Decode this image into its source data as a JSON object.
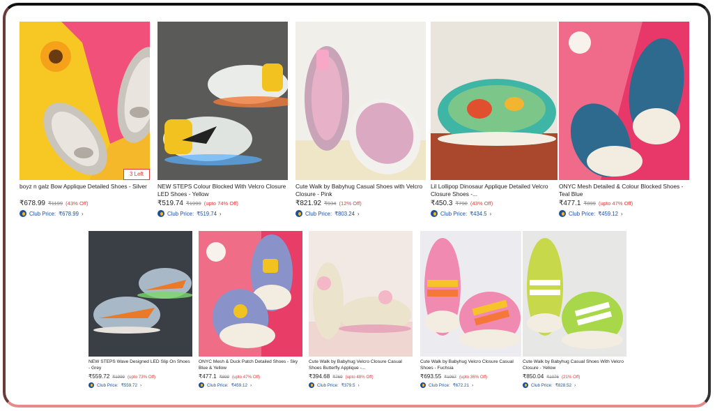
{
  "colors": {
    "club_blue": "#1d4f9c",
    "discount_red": "#e23b3b",
    "frame_bottom": "#e98a8a"
  },
  "products_row1": [
    {
      "title": "boyz n galz Bow Applique Detailed Shoes - Silver",
      "price": "₹678.99",
      "mrp": "₹1199",
      "discount": "(43% Off)",
      "club_label": "Club Price:",
      "club_price": "₹678.99",
      "badge": "3 Left",
      "chevron": "›"
    },
    {
      "title": "NEW STEPS Colour Blocked With Velcro Closure LED Shoes - Yellow",
      "price": "₹519.74",
      "mrp": "₹1999",
      "discount": "(upto 74% Off)",
      "club_label": "Club Price:",
      "club_price": "₹519.74",
      "chevron": "›"
    },
    {
      "title": "Cute Walk by Babyhug Casual Shoes with Velcro Closure - Pink",
      "price": "₹821.92",
      "mrp": "₹934",
      "discount": "(12% Off)",
      "club_label": "Club Price:",
      "club_price": "₹803.24",
      "chevron": "›"
    },
    {
      "title": "Lil Lollipop Dinosaur Applique Detailed Velcro Closure Shoes -...",
      "price": "₹450.3",
      "mrp": "₹790",
      "discount": "(43% Off)",
      "club_label": "Club Price:",
      "club_price": "₹434.5",
      "chevron": "›"
    },
    {
      "title": "ONYC Mesh Detailed & Colour Blocked Shoes - Teal Blue",
      "price": "₹477.1",
      "mrp": "₹899",
      "discount": "(upto 47% Off)",
      "club_label": "Club Price:",
      "club_price": "₹459.12",
      "chevron": "›"
    }
  ],
  "products_row2": [
    {
      "title": "NEW STEPS Wave Designed LED Slip On Shoes - Grey",
      "price": "₹559.72",
      "mrp": "₹1999",
      "discount": "(upto 73% Off)",
      "club_label": "Club Price:",
      "club_price": "₹559.72",
      "chevron": "›"
    },
    {
      "title": "ONYC Mesh & Duck Patch Detailed Shoes - Sky Blue & Yellow",
      "price": "₹477.1",
      "mrp": "₹899",
      "discount": "(upto 47% Off)",
      "club_label": "Club Price:",
      "club_price": "₹459.12",
      "chevron": "›"
    },
    {
      "title": "Cute Walk by Babyhug Velcro Closure Casual Shoes Butterfly Applique -...",
      "price": "₹394.68",
      "mrp": "₹769",
      "discount": "(upto 48% Off)",
      "club_label": "Club Price:",
      "club_price": "₹379.5",
      "chevron": "›"
    },
    {
      "title": "Cute Walk by Babyhug Velcro Closure Casual Shoes - Fuchsia",
      "price": "₹693.55",
      "mrp": "₹1067",
      "discount": "(upto 36% Off)",
      "club_label": "Club Price:",
      "club_price": "₹672.21",
      "chevron": "›"
    },
    {
      "title": "Cute Walk by Babyhug Casual Shoes With Velcro Closure - Yellow",
      "price": "₹850.04",
      "mrp": "₹1076",
      "discount": "(21% Off)",
      "club_label": "Club Price:",
      "club_price": "₹828.52",
      "chevron": "›"
    }
  ]
}
